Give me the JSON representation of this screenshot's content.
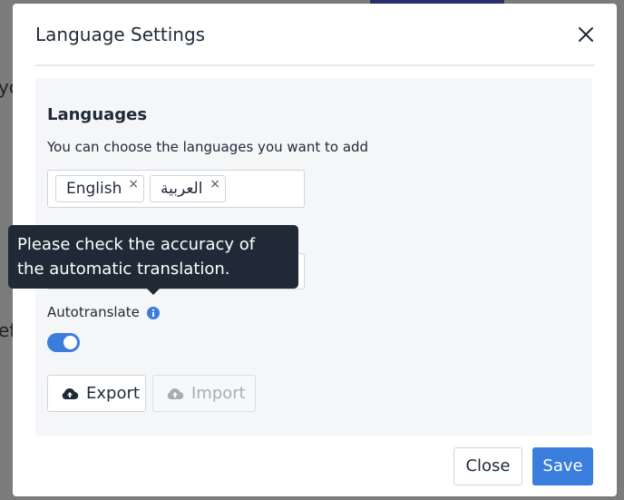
{
  "background": {
    "fragment_top": "yo",
    "fragment_bottom": "ef"
  },
  "dialog": {
    "title": "Language Settings",
    "close_icon": "close-icon"
  },
  "languages": {
    "title": "Languages",
    "description": "You can choose the languages you want to add",
    "selected": [
      "English",
      "العربية"
    ],
    "remove_icon": "×"
  },
  "autotranslate": {
    "label": "Autotranslate",
    "info_icon": "info-icon",
    "enabled": true,
    "tooltip_line1": "Please check the accuracy of",
    "tooltip_line2": "the automatic translation."
  },
  "actions": {
    "export_label": "Export",
    "export_icon": "cloud-upload-icon",
    "import_label": "Import",
    "import_icon": "cloud-download-icon"
  },
  "footer": {
    "close_label": "Close",
    "save_label": "Save"
  },
  "colors": {
    "primary": "#3b7ddd",
    "tooltip_bg": "#1f2a36",
    "panel_bg": "#f5f6f8"
  }
}
